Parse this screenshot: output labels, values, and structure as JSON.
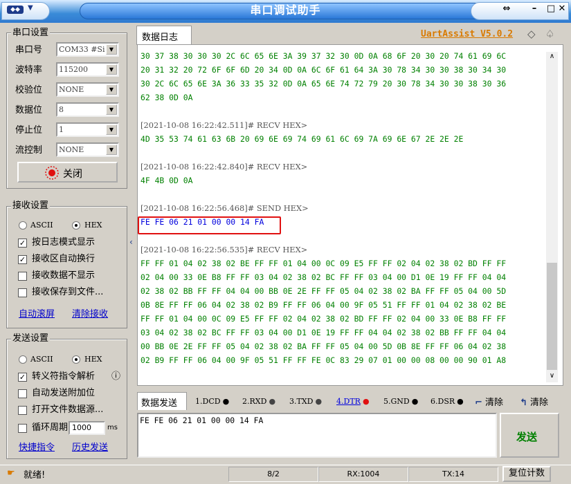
{
  "window": {
    "title": "串口调试助手"
  },
  "brand": {
    "name": "UartAssist V5.0.2",
    "accent": "#d97a00"
  },
  "serial_settings": {
    "legend": "串口设置",
    "port": {
      "label": "串口号",
      "value": "COM33 #Si"
    },
    "baud": {
      "label": "波特率",
      "value": "115200"
    },
    "parity": {
      "label": "校验位",
      "value": "NONE"
    },
    "databits": {
      "label": "数据位",
      "value": "8"
    },
    "stopbits": {
      "label": "停止位",
      "value": "1"
    },
    "flow": {
      "label": "流控制",
      "value": "NONE"
    },
    "close_button": "关闭"
  },
  "receive_settings": {
    "legend": "接收设置",
    "ascii": "ASCII",
    "hex": "HEX",
    "selected": "HEX",
    "opt_log_mode": "按日志模式显示",
    "opt_auto_wrap": "接收区自动换行",
    "opt_hide": "接收数据不显示",
    "opt_save": "接收保存到文件...",
    "link_autoscroll": "自动滚屏",
    "link_clear": "清除接收"
  },
  "send_settings": {
    "legend": "发送设置",
    "ascii": "ASCII",
    "hex": "HEX",
    "selected": "HEX",
    "opt_escape": "转义符指令解析",
    "opt_append": "自动发送附加位",
    "opt_file": "打开文件数据源...",
    "opt_cycle": "循环周期",
    "cycle_value": "1000",
    "cycle_unit": "ms",
    "link_quick": "快捷指令",
    "link_history": "历史发送"
  },
  "log": {
    "tab": "数据日志",
    "lines": [
      {
        "text": "30 37 38 30 30 30 2C 6C 65 6E 3A 39 37 32 30 0D 0A 68 6F 20 30 20 74 61 69 6C",
        "kind": "green"
      },
      {
        "text": "20 31 32 20 72 6F 6F 6D 20 34 0D 0A 6C 6F 61 64 3A 30 78 34 30 30 38 30 34 30",
        "kind": "green"
      },
      {
        "text": "30 2C 6C 65 6E 3A 36 33 35 32 0D 0A 65 6E 74 72 79 20 30 78 34 30 30 38 30 36",
        "kind": "green"
      },
      {
        "text": "62 38 0D 0A",
        "kind": "green"
      },
      {
        "text": "",
        "kind": "green"
      },
      {
        "text": "[2021-10-08 16:22:42.511]# RECV HEX>",
        "kind": "gray"
      },
      {
        "text": "4D 35 53 74 61 63 6B 20 69 6E 69 74 69 61 6C 69 7A 69 6E 67 2E 2E 2E",
        "kind": "green"
      },
      {
        "text": "",
        "kind": "green"
      },
      {
        "text": "[2021-10-08 16:22:42.840]# RECV HEX>",
        "kind": "gray"
      },
      {
        "text": "4F 4B 0D 0A",
        "kind": "green"
      },
      {
        "text": "",
        "kind": "green"
      },
      {
        "text": "[2021-10-08 16:22:56.468]# SEND HEX>",
        "kind": "gray"
      },
      {
        "text": "FE FE 06 21 01 00 00 14 FA",
        "kind": "blue"
      },
      {
        "text": "",
        "kind": "green"
      },
      {
        "text": "[2021-10-08 16:22:56.535]# RECV HEX>",
        "kind": "gray"
      },
      {
        "text": "FF FF 01 04 02 38 02 BE FF FF 01 04 00 0C 09 E5 FF FF 02 04 02 38 02 BD FF FF",
        "kind": "green"
      },
      {
        "text": "02 04 00 33 0E B8 FF FF 03 04 02 38 02 BC FF FF 03 04 00 D1 0E 19 FF FF 04 04",
        "kind": "green"
      },
      {
        "text": "02 38 02 BB FF FF 04 04 00 BB 0E 2E FF FF 05 04 02 38 02 BA FF FF 05 04 00 5D",
        "kind": "green"
      },
      {
        "text": "0B 8E FF FF 06 04 02 38 02 B9 FF FF 06 04 00 9F 05 51 FF FF 01 04 02 38 02 BE",
        "kind": "green"
      },
      {
        "text": "FF FF 01 04 00 0C 09 E5 FF FF 02 04 02 38 02 BD FF FF 02 04 00 33 0E B8 FF FF",
        "kind": "green"
      },
      {
        "text": "03 04 02 38 02 BC FF FF 03 04 00 D1 0E 19 FF FF 04 04 02 38 02 BB FF FF 04 04",
        "kind": "green"
      },
      {
        "text": "00 BB 0E 2E FF FF 05 04 02 38 02 BA FF FF 05 04 00 5D 0B 8E FF FF 06 04 02 38",
        "kind": "green"
      },
      {
        "text": "02 B9 FF FF 06 04 00 9F 05 51 FF FF FE 0C 83 29 07 01 00 00 08 00 00 90 01 A8",
        "kind": "green"
      }
    ]
  },
  "send": {
    "tab": "数据发送",
    "pins": [
      {
        "label": "1.DCD",
        "color": "#000000"
      },
      {
        "label": "2.RXD",
        "color": "#444444"
      },
      {
        "label": "3.TXD",
        "color": "#444444"
      },
      {
        "label": "4.DTR",
        "color": "#e01010",
        "active": true
      },
      {
        "label": "5.GND",
        "color": "#000000"
      },
      {
        "label": "6.DSR",
        "color": "#000000"
      }
    ],
    "clear1": "清除",
    "clear2": "清除",
    "input_value": "FE FE 06 21 01 00 00 14 FA",
    "send_button": "发送"
  },
  "status": {
    "ready": "就绪!",
    "counter": "8/2",
    "rx": "RX:1004",
    "tx": "TX:14",
    "reset": "复位计数"
  }
}
